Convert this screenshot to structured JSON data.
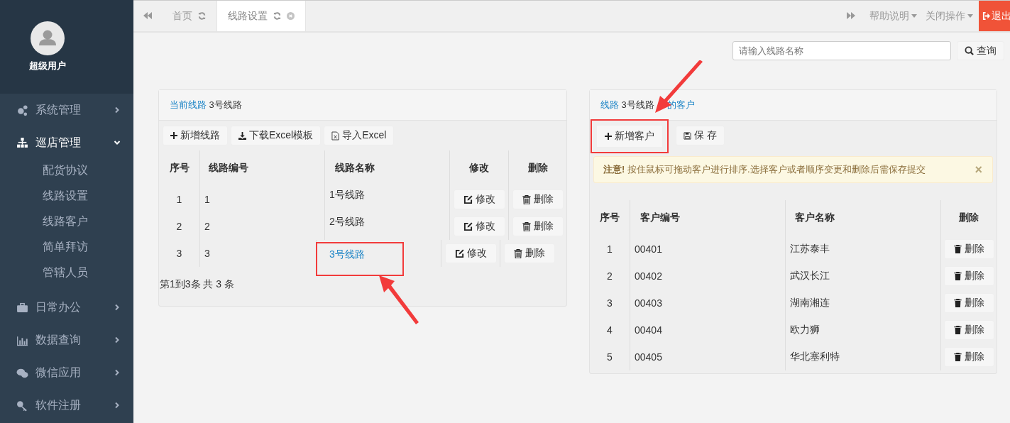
{
  "sidebar": {
    "user": "超级用户",
    "items": [
      {
        "label": "系统管理",
        "kind": "gears",
        "expanded": false
      },
      {
        "label": "巡店管理",
        "kind": "sitemap",
        "expanded": true,
        "children": [
          {
            "label": "配货协议"
          },
          {
            "label": "线路设置"
          },
          {
            "label": "线路客户"
          },
          {
            "label": "简单拜访"
          },
          {
            "label": "管辖人员"
          }
        ]
      },
      {
        "label": "日常办公",
        "kind": "briefcase",
        "expanded": false
      },
      {
        "label": "数据查询",
        "kind": "chart",
        "expanded": false
      },
      {
        "label": "微信应用",
        "kind": "chat",
        "expanded": false
      },
      {
        "label": "软件注册",
        "kind": "key",
        "expanded": false
      }
    ]
  },
  "tabs": [
    {
      "label": "首页",
      "selected": false,
      "closable": false
    },
    {
      "label": "线路设置",
      "selected": true,
      "closable": true
    }
  ],
  "top_menus": [
    "帮助说明",
    "关闭操作"
  ],
  "logout": "退出",
  "search": {
    "placeholder": "请输入线路名称",
    "button": "查询"
  },
  "routes_panel": {
    "title_label": "当前线路",
    "title_value": "3号线路",
    "toolbar": [
      {
        "label": "新增线路",
        "kind": "plus",
        "highlighted": false
      },
      {
        "label": "下载Excel模板",
        "kind": "download",
        "highlighted": false
      },
      {
        "label": "导入Excel",
        "kind": "excel",
        "highlighted": false
      }
    ],
    "columns": [
      "序号",
      "线路编号",
      "线路名称",
      "修改",
      "删除"
    ],
    "rows": [
      {
        "no": "1",
        "code": "1",
        "name": "1号线路",
        "selected": false,
        "highlighted": false,
        "edit": "修改",
        "delete": "删除"
      },
      {
        "no": "2",
        "code": "2",
        "name": "2号线路",
        "selected": false,
        "highlighted": false,
        "edit": "修改",
        "delete": "删除"
      },
      {
        "no": "3",
        "code": "3",
        "name": "3号线路",
        "selected": true,
        "highlighted": true,
        "edit": "修改",
        "delete": "删除"
      }
    ],
    "footer": "第1到3条 共 3 条"
  },
  "customers_panel": {
    "title_label": "线路",
    "title_value": "3号线路",
    "title_suffix": "的客户",
    "toolbar": [
      {
        "label": "新增客户",
        "kind": "plus",
        "highlighted": true
      },
      {
        "label": "保 存",
        "kind": "save",
        "highlighted": false
      }
    ],
    "alert": {
      "strong": "注意!",
      "text": "按住鼠标可拖动客户进行排序.选择客户或者顺序变更和删除后需保存提交",
      "close": "×"
    },
    "columns": [
      "序号",
      "客户编号",
      "客户名称",
      "删除"
    ],
    "rows": [
      {
        "no": "1",
        "code": "00401",
        "name": "江苏泰丰",
        "delete": "删除"
      },
      {
        "no": "2",
        "code": "00402",
        "name": "武汉长江",
        "delete": "删除"
      },
      {
        "no": "3",
        "code": "00403",
        "name": "湖南湘连",
        "delete": "删除"
      },
      {
        "no": "4",
        "code": "00404",
        "name": "欧力狮",
        "delete": "删除"
      },
      {
        "no": "5",
        "code": "00405",
        "name": "华北塞利特",
        "delete": "删除"
      }
    ]
  }
}
